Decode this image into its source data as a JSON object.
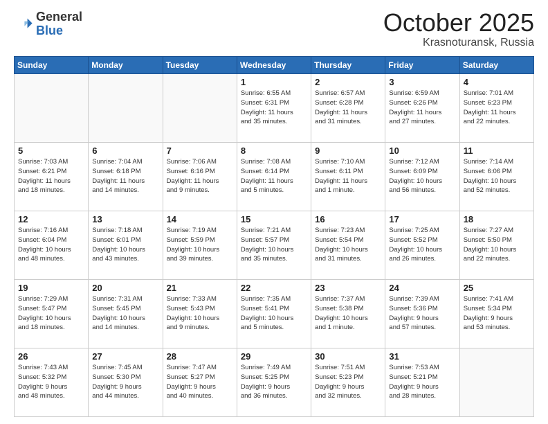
{
  "header": {
    "logo_general": "General",
    "logo_blue": "Blue",
    "month": "October 2025",
    "location": "Krasnoturansk, Russia"
  },
  "days_of_week": [
    "Sunday",
    "Monday",
    "Tuesday",
    "Wednesday",
    "Thursday",
    "Friday",
    "Saturday"
  ],
  "weeks": [
    [
      {
        "day": "",
        "info": ""
      },
      {
        "day": "",
        "info": ""
      },
      {
        "day": "",
        "info": ""
      },
      {
        "day": "1",
        "info": "Sunrise: 6:55 AM\nSunset: 6:31 PM\nDaylight: 11 hours\nand 35 minutes."
      },
      {
        "day": "2",
        "info": "Sunrise: 6:57 AM\nSunset: 6:28 PM\nDaylight: 11 hours\nand 31 minutes."
      },
      {
        "day": "3",
        "info": "Sunrise: 6:59 AM\nSunset: 6:26 PM\nDaylight: 11 hours\nand 27 minutes."
      },
      {
        "day": "4",
        "info": "Sunrise: 7:01 AM\nSunset: 6:23 PM\nDaylight: 11 hours\nand 22 minutes."
      }
    ],
    [
      {
        "day": "5",
        "info": "Sunrise: 7:03 AM\nSunset: 6:21 PM\nDaylight: 11 hours\nand 18 minutes."
      },
      {
        "day": "6",
        "info": "Sunrise: 7:04 AM\nSunset: 6:18 PM\nDaylight: 11 hours\nand 14 minutes."
      },
      {
        "day": "7",
        "info": "Sunrise: 7:06 AM\nSunset: 6:16 PM\nDaylight: 11 hours\nand 9 minutes."
      },
      {
        "day": "8",
        "info": "Sunrise: 7:08 AM\nSunset: 6:14 PM\nDaylight: 11 hours\nand 5 minutes."
      },
      {
        "day": "9",
        "info": "Sunrise: 7:10 AM\nSunset: 6:11 PM\nDaylight: 11 hours\nand 1 minute."
      },
      {
        "day": "10",
        "info": "Sunrise: 7:12 AM\nSunset: 6:09 PM\nDaylight: 10 hours\nand 56 minutes."
      },
      {
        "day": "11",
        "info": "Sunrise: 7:14 AM\nSunset: 6:06 PM\nDaylight: 10 hours\nand 52 minutes."
      }
    ],
    [
      {
        "day": "12",
        "info": "Sunrise: 7:16 AM\nSunset: 6:04 PM\nDaylight: 10 hours\nand 48 minutes."
      },
      {
        "day": "13",
        "info": "Sunrise: 7:18 AM\nSunset: 6:01 PM\nDaylight: 10 hours\nand 43 minutes."
      },
      {
        "day": "14",
        "info": "Sunrise: 7:19 AM\nSunset: 5:59 PM\nDaylight: 10 hours\nand 39 minutes."
      },
      {
        "day": "15",
        "info": "Sunrise: 7:21 AM\nSunset: 5:57 PM\nDaylight: 10 hours\nand 35 minutes."
      },
      {
        "day": "16",
        "info": "Sunrise: 7:23 AM\nSunset: 5:54 PM\nDaylight: 10 hours\nand 31 minutes."
      },
      {
        "day": "17",
        "info": "Sunrise: 7:25 AM\nSunset: 5:52 PM\nDaylight: 10 hours\nand 26 minutes."
      },
      {
        "day": "18",
        "info": "Sunrise: 7:27 AM\nSunset: 5:50 PM\nDaylight: 10 hours\nand 22 minutes."
      }
    ],
    [
      {
        "day": "19",
        "info": "Sunrise: 7:29 AM\nSunset: 5:47 PM\nDaylight: 10 hours\nand 18 minutes."
      },
      {
        "day": "20",
        "info": "Sunrise: 7:31 AM\nSunset: 5:45 PM\nDaylight: 10 hours\nand 14 minutes."
      },
      {
        "day": "21",
        "info": "Sunrise: 7:33 AM\nSunset: 5:43 PM\nDaylight: 10 hours\nand 9 minutes."
      },
      {
        "day": "22",
        "info": "Sunrise: 7:35 AM\nSunset: 5:41 PM\nDaylight: 10 hours\nand 5 minutes."
      },
      {
        "day": "23",
        "info": "Sunrise: 7:37 AM\nSunset: 5:38 PM\nDaylight: 10 hours\nand 1 minute."
      },
      {
        "day": "24",
        "info": "Sunrise: 7:39 AM\nSunset: 5:36 PM\nDaylight: 9 hours\nand 57 minutes."
      },
      {
        "day": "25",
        "info": "Sunrise: 7:41 AM\nSunset: 5:34 PM\nDaylight: 9 hours\nand 53 minutes."
      }
    ],
    [
      {
        "day": "26",
        "info": "Sunrise: 7:43 AM\nSunset: 5:32 PM\nDaylight: 9 hours\nand 48 minutes."
      },
      {
        "day": "27",
        "info": "Sunrise: 7:45 AM\nSunset: 5:30 PM\nDaylight: 9 hours\nand 44 minutes."
      },
      {
        "day": "28",
        "info": "Sunrise: 7:47 AM\nSunset: 5:27 PM\nDaylight: 9 hours\nand 40 minutes."
      },
      {
        "day": "29",
        "info": "Sunrise: 7:49 AM\nSunset: 5:25 PM\nDaylight: 9 hours\nand 36 minutes."
      },
      {
        "day": "30",
        "info": "Sunrise: 7:51 AM\nSunset: 5:23 PM\nDaylight: 9 hours\nand 32 minutes."
      },
      {
        "day": "31",
        "info": "Sunrise: 7:53 AM\nSunset: 5:21 PM\nDaylight: 9 hours\nand 28 minutes."
      },
      {
        "day": "",
        "info": ""
      }
    ]
  ]
}
